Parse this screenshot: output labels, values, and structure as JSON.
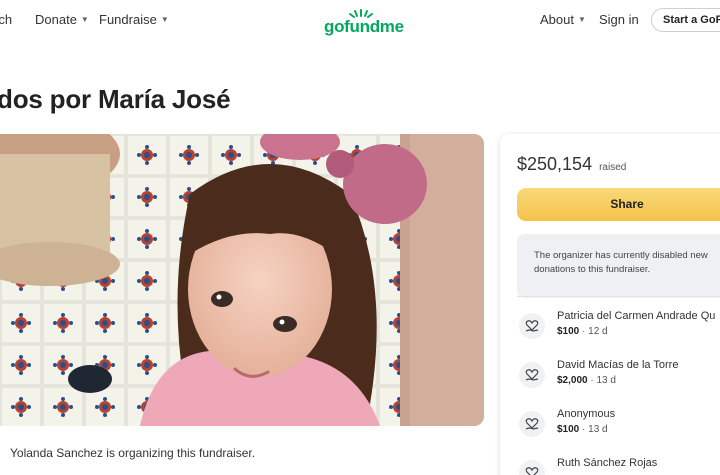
{
  "header": {
    "search_label": "rch",
    "donate_label": "Donate",
    "fundraise_label": "Fundraise",
    "logo_text": "gofundme",
    "about_label": "About",
    "signin_label": "Sign in",
    "cta_label": "Start a GoFu"
  },
  "campaign": {
    "title": "idos por María José",
    "organizer_text": "Yolanda Sanchez is organizing this fundraiser."
  },
  "donation_card": {
    "amount": "$250,154",
    "amount_suffix": "raised",
    "share_label": "Share",
    "notice": "The organizer has currently disabled new donations to this fundraiser."
  },
  "donations": [
    {
      "name": "Patricia del Carmen Andrade Qu",
      "amount": "$100",
      "age": "12 d"
    },
    {
      "name": "David Macías de la Torre",
      "amount": "$2,000",
      "age": "13 d"
    },
    {
      "name": "Anonymous",
      "amount": "$100",
      "age": "13 d"
    },
    {
      "name": "Ruth Sánchez Rojas",
      "amount": "",
      "age": ""
    }
  ],
  "icons": {
    "donor_icon": "heart-hand-icon",
    "caret": "chevron-down-icon"
  },
  "colors": {
    "brand_green": "#02a95c",
    "share_button": "#f5c24a"
  }
}
